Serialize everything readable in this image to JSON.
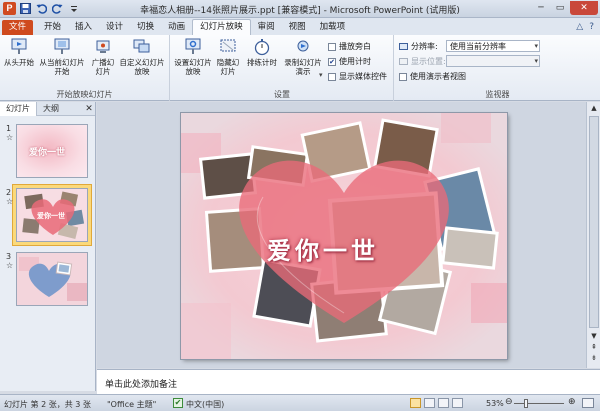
{
  "window": {
    "title": "幸福恋人相册--14张照片展示.ppt [兼容模式] - Microsoft PowerPoint (试用版)",
    "app_logo": "P",
    "quick_access": [
      "save-icon",
      "undo-icon",
      "redo-icon",
      "customize-icon"
    ],
    "controls": {
      "minimize": "─",
      "restore": "▭",
      "close": "✕"
    }
  },
  "ribbon_tabs": [
    "文件",
    "开始",
    "插入",
    "设计",
    "切换",
    "动画",
    "幻灯片放映",
    "审阅",
    "视图",
    "加载项"
  ],
  "active_tab": "幻灯片放映",
  "ribbon_tabs_right": [
    "△",
    "?"
  ],
  "ribbon": {
    "group_start": {
      "label": "开始放映幻灯片",
      "from_start": "从头开始",
      "from_current": "从当前幻灯片开始",
      "broadcast": "广播幻灯片",
      "custom": "自定义幻灯片放映"
    },
    "group_setup": {
      "label": "设置",
      "setup_show": "设置幻灯片放映",
      "hide_slide": "隐藏幻灯片",
      "rehearse": "排练计时",
      "record": "录制幻灯片演示",
      "play_narration": "播放旁白",
      "use_timings": "使用计时",
      "show_media": "显示媒体控件"
    },
    "group_monitors": {
      "label": "监视器",
      "resolution_label": "分辨率:",
      "resolution_value": "使用当前分辨率",
      "show_on_label": "显示位置:",
      "presenter_view": "使用演示者视图"
    }
  },
  "checkboxes": {
    "play_narration": false,
    "use_timings": true,
    "show_media": false,
    "presenter_view": false
  },
  "left_panel": {
    "tabs": [
      "幻灯片",
      "大纲"
    ],
    "close": "✕",
    "slides": [
      {
        "num": "1",
        "title": "爱你一世",
        "selected": false
      },
      {
        "num": "2",
        "title": "爱你一世",
        "selected": true
      },
      {
        "num": "3",
        "title": "",
        "selected": false
      }
    ]
  },
  "slide": {
    "caption": "爱你一世"
  },
  "scroll_arrows": {
    "up": "▲",
    "down": "▼",
    "page_up": "⇞",
    "page_down": "⇟"
  },
  "notes": {
    "placeholder": "单击此处添加备注"
  },
  "status": {
    "slide_info": "幻灯片 第 2 张，共 3 张",
    "theme": "\"Office 主题\"",
    "language": "中文(中国)",
    "zoom": "53%",
    "zoom_level": 0.53
  },
  "colors": {
    "file_tab": "#cf4a1e",
    "heart": "#e96a78",
    "close_button": "#c9483a",
    "selected_thumb": "#fbd97a"
  }
}
